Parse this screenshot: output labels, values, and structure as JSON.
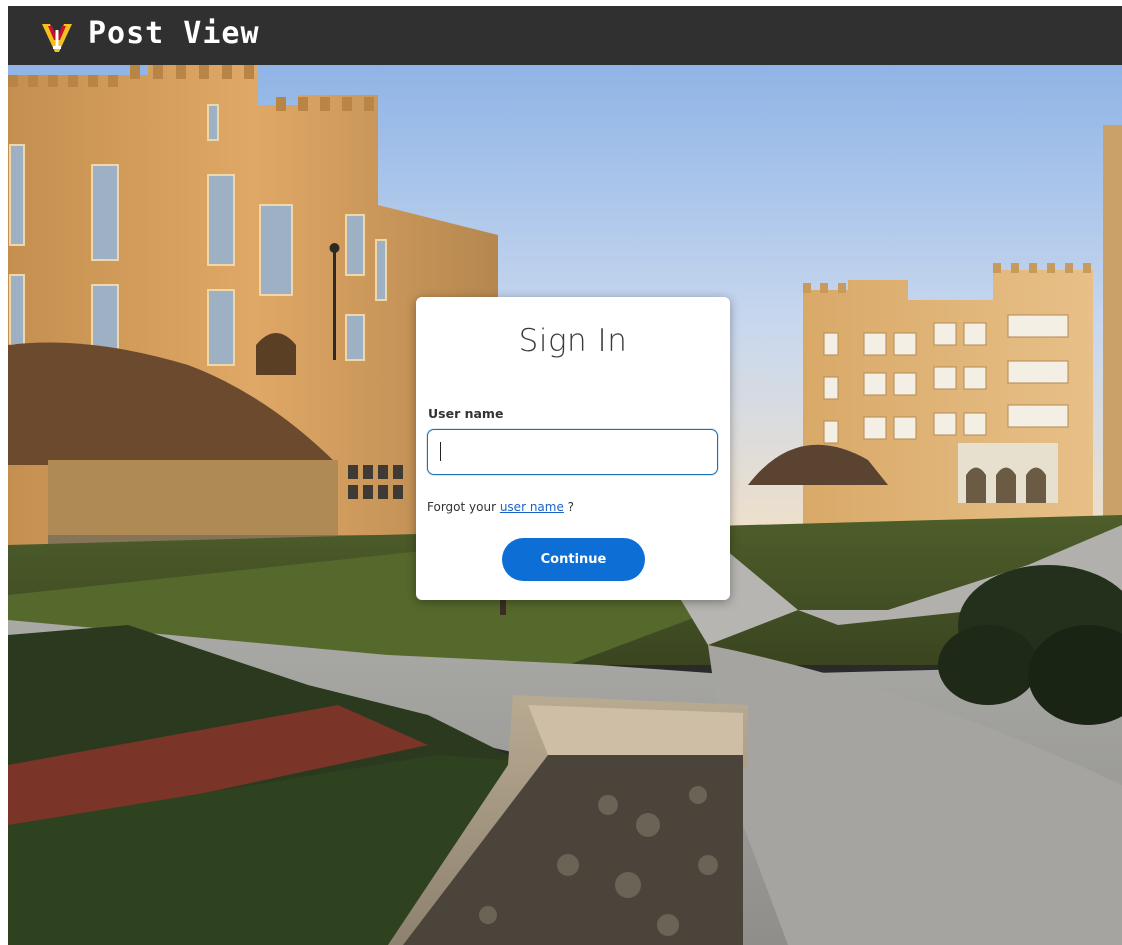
{
  "header": {
    "app_title": "Post View",
    "logo_icon": "vmi-logo-icon"
  },
  "signin": {
    "title": "Sign In",
    "username_label": "User name",
    "username_value": "",
    "forgot_prefix": "Forgot your ",
    "forgot_link": "user name",
    "forgot_suffix": " ?",
    "continue_label": "Continue"
  },
  "colors": {
    "topbar": "#303030",
    "accent": "#0d6fd6",
    "link": "#1a62c5",
    "input_border": "#1a6fb5"
  }
}
